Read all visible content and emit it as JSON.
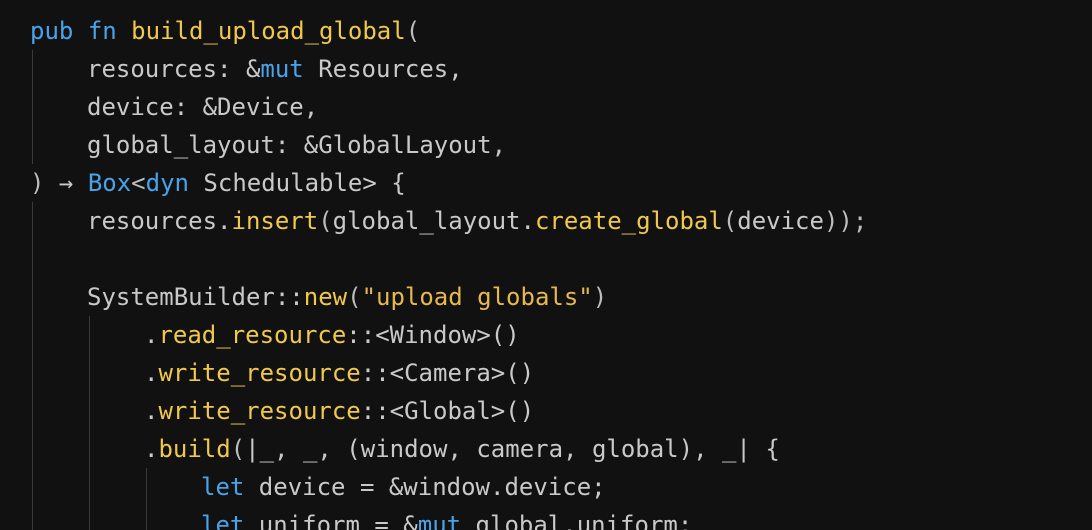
{
  "editor": {
    "language": "rust",
    "theme_colors": {
      "background": "#111112",
      "text": "#c9c9c9",
      "keyword": "#4aa3e8",
      "function": "#f0c84b",
      "string": "#e6b84e",
      "indent_guide": "#3a3a3d"
    },
    "lines": [
      {
        "indent": 0,
        "tokens": [
          [
            "kw",
            "pub"
          ],
          [
            "tx",
            " "
          ],
          [
            "kw",
            "fn"
          ],
          [
            "tx",
            " "
          ],
          [
            "fn",
            "build_upload_global"
          ],
          [
            "pn",
            "("
          ]
        ]
      },
      {
        "indent": 1,
        "tokens": [
          [
            "tx",
            "resources: &"
          ],
          [
            "kw",
            "mut"
          ],
          [
            "tx",
            " Resources,"
          ]
        ]
      },
      {
        "indent": 1,
        "tokens": [
          [
            "tx",
            "device: &Device,"
          ]
        ]
      },
      {
        "indent": 1,
        "tokens": [
          [
            "tx",
            "global_layout: &GlobalLayout,"
          ]
        ]
      },
      {
        "indent": 0,
        "tokens": [
          [
            "pn",
            ") "
          ],
          [
            "tx",
            "→"
          ],
          [
            "pn",
            " "
          ],
          [
            "kw",
            "Box"
          ],
          [
            "pn",
            "<"
          ],
          [
            "kw",
            "dyn"
          ],
          [
            "tx",
            " Schedulable> {"
          ]
        ]
      },
      {
        "indent": 1,
        "tokens": [
          [
            "tx",
            "resources."
          ],
          [
            "fn",
            "insert"
          ],
          [
            "pn",
            "("
          ],
          [
            "tx",
            "global_layout."
          ],
          [
            "fn",
            "create_global"
          ],
          [
            "pn",
            "("
          ],
          [
            "tx",
            "device"
          ],
          [
            "pn",
            "));"
          ]
        ]
      },
      {
        "indent": 1,
        "tokens": []
      },
      {
        "indent": 1,
        "tokens": [
          [
            "tx",
            "SystemBuilder::"
          ],
          [
            "fn",
            "new"
          ],
          [
            "pn",
            "("
          ],
          [
            "str",
            "\"upload globals\""
          ],
          [
            "pn",
            ")"
          ]
        ]
      },
      {
        "indent": 2,
        "tokens": [
          [
            "tx",
            "."
          ],
          [
            "fn",
            "read_resource"
          ],
          [
            "tx",
            "::<Window>()"
          ]
        ]
      },
      {
        "indent": 2,
        "tokens": [
          [
            "tx",
            "."
          ],
          [
            "fn",
            "write_resource"
          ],
          [
            "tx",
            "::<Camera>()"
          ]
        ]
      },
      {
        "indent": 2,
        "tokens": [
          [
            "tx",
            "."
          ],
          [
            "fn",
            "write_resource"
          ],
          [
            "tx",
            "::<Global>()"
          ]
        ]
      },
      {
        "indent": 2,
        "tokens": [
          [
            "tx",
            "."
          ],
          [
            "fn",
            "build"
          ],
          [
            "pn",
            "("
          ],
          [
            "tx",
            "|_, _, (window, camera, global), _| {"
          ]
        ]
      },
      {
        "indent": 3,
        "tokens": [
          [
            "kw",
            "let"
          ],
          [
            "tx",
            " device = &window.device;"
          ]
        ]
      },
      {
        "indent": 3,
        "tokens": [
          [
            "kw",
            "let"
          ],
          [
            "tx",
            " uniform = &"
          ],
          [
            "kw",
            "mut"
          ],
          [
            "tx",
            " global.uniform;"
          ]
        ]
      }
    ]
  }
}
